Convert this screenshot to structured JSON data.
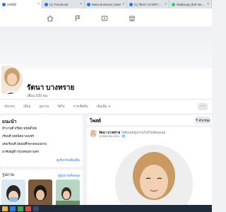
{
  "browser": {
    "tabs": [
      {
        "label": "เฟซบุ๊ก",
        "active": true,
        "color": "#1877f2"
      },
      {
        "label": "(1) Facebook",
        "active": false,
        "color": "#1877f2"
      },
      {
        "label": "Meta Business Suite",
        "active": false,
        "color": "#0a7cff"
      },
      {
        "label": "(1) รัตนา บางทราย | Facebook",
        "active": false,
        "color": "#1877f2"
      },
      {
        "label": "WaBoopy (full Version)[Multi...",
        "active": false,
        "color": "#25d366"
      }
    ]
  },
  "fbnav": {
    "icons": [
      "home-icon",
      "flag-icon",
      "video-icon",
      "marketplace-icon"
    ]
  },
  "profile": {
    "name": "รัตนา บางทราย",
    "friends": "เพื่อน 635 คน",
    "nav_items": [
      "เกี่ยวกับ",
      "เพื่อน",
      "รูปภาพ",
      "วิดีโอ",
      "การเช็คอิน",
      "เพิ่มเติม"
    ],
    "more_label": "···"
  },
  "intro": {
    "title": "แนะนำ",
    "line1": "ทำงานที่ บริษัท ฟรุตส์ไทย",
    "line2": "เรียนที่ เทคนิคบางเพชร",
    "line3": "เคยเรียนที่ มัธยมศึกษาตอนปลาย",
    "line4": "อาศัยอยู่ที่ กรุงเทพมหานคร",
    "link": "ดูเกี่ยวกับเพิ่มเติม"
  },
  "photos": {
    "title": "รูปภาพ",
    "count_label": "ดูรูปภาพทั้งหมด",
    "link": "ดูรูปภาพทั้งหมด"
  },
  "posts": {
    "title": "โพสต์",
    "filter_label": "ตัวกรอง"
  },
  "post": {
    "author": "รัตนา บางทราย",
    "action": " ได้อัปเดตรูปภาพโปรไฟล์ของเธอ",
    "time": "13 มิถุนายน 2021 · 🌐"
  },
  "colors": {
    "facebook_blue": "#1877f2",
    "link_blue": "#216fdb",
    "page_bg": "#f0f2f5",
    "taskbar": "#1f2a3a"
  }
}
